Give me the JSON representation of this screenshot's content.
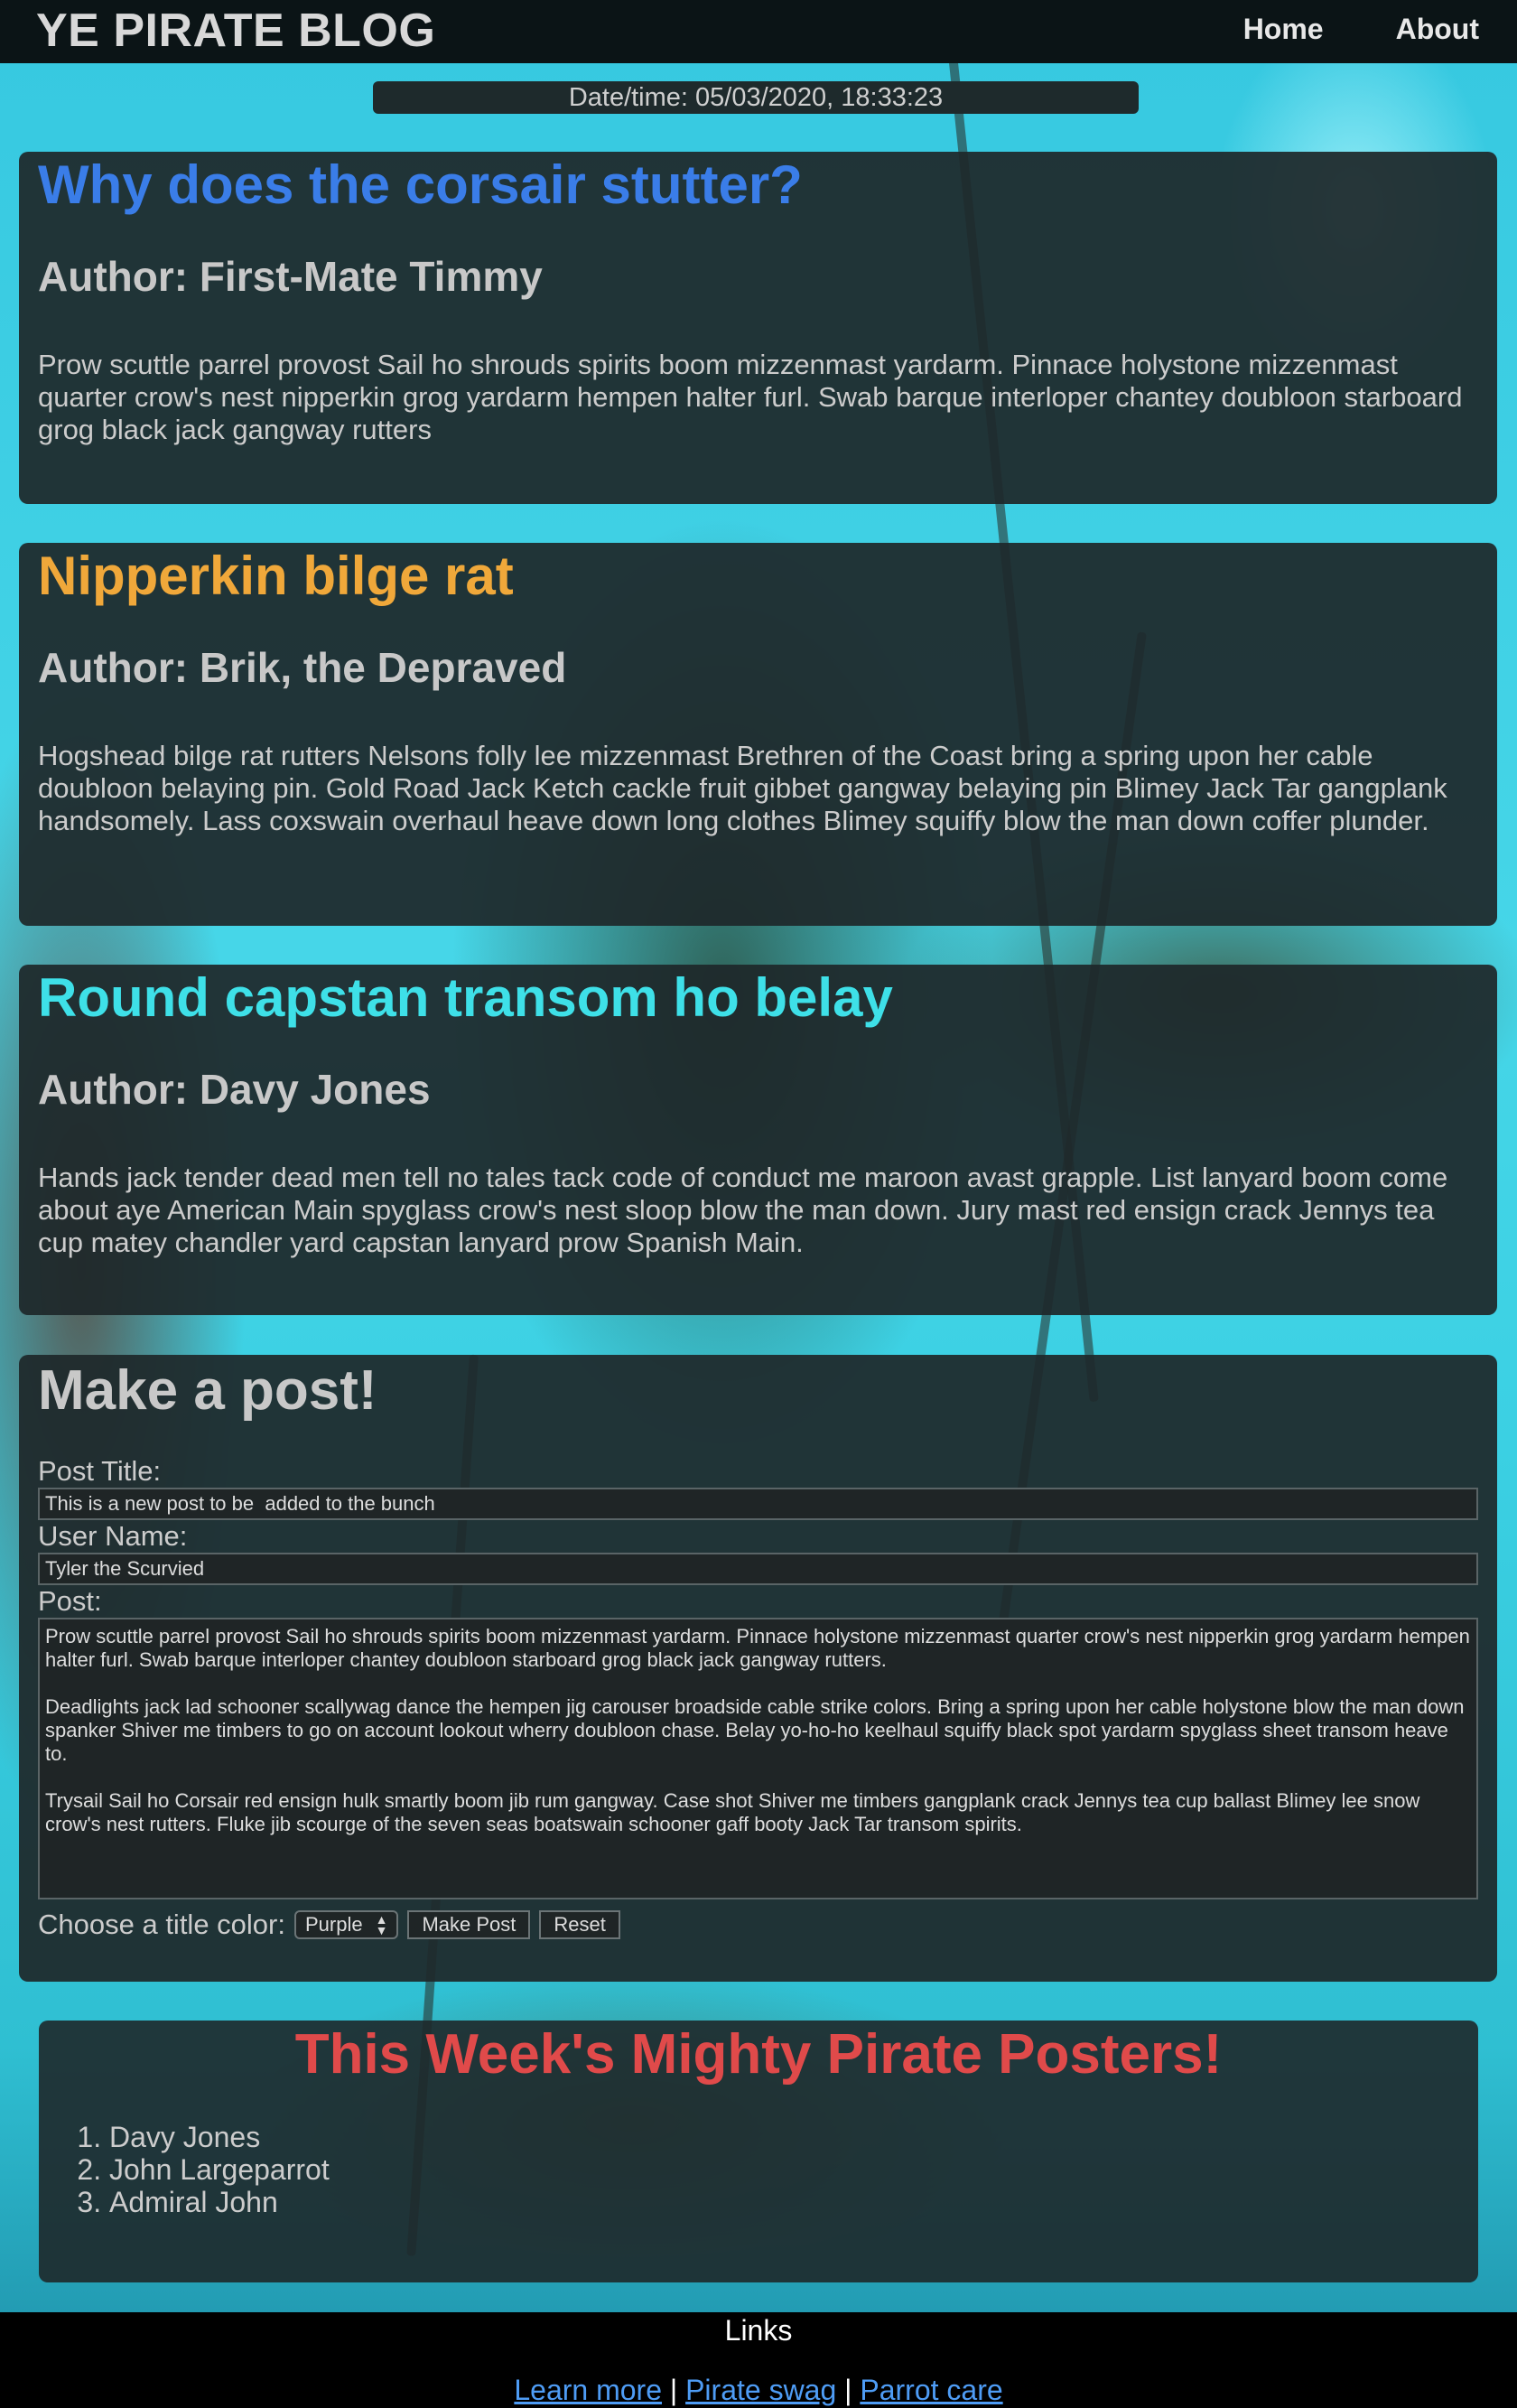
{
  "header": {
    "brand": "YE PIRATE BLOG",
    "nav": [
      "Home",
      "About"
    ]
  },
  "datetime": "Date/time: 05/03/2020, 18:33:23",
  "posts": [
    {
      "title": "Why does the corsair stutter?",
      "title_color": "#3a7de8",
      "author": "Author: First-Mate Timmy",
      "body": "Prow scuttle parrel provost Sail ho shrouds spirits boom mizzenmast yardarm. Pinnace holystone mizzenmast quarter crow's nest nipperkin grog yardarm hempen halter furl. Swab barque interloper chantey doubloon starboard grog black jack gangway rutters"
    },
    {
      "title": "Nipperkin bilge rat",
      "title_color": "#f0a83a",
      "author": "Author: Brik, the Depraved",
      "body": "Hogshead bilge rat rutters Nelsons folly lee mizzenmast Brethren of the Coast bring a spring upon her cable doubloon belaying pin. Gold Road Jack Ketch cackle fruit gibbet gangway belaying pin Blimey Jack Tar gangplank handsomely. Lass coxswain overhaul heave down long clothes Blimey squiffy blow the man down coffer plunder."
    },
    {
      "title": "Round capstan transom ho belay",
      "title_color": "#3ee0e8",
      "author": "Author: Davy Jones",
      "body": "Hands jack tender dead men tell no tales tack code of conduct me maroon avast grapple. List lanyard boom come about aye American Main spyglass crow's nest sloop blow the man down. Jury mast red ensign crack Jennys tea cup matey chandler yard capstan lanyard prow Spanish Main."
    }
  ],
  "form": {
    "heading": "Make a post!",
    "title_label": "Post Title:",
    "title_value": "This is a new post to be  added to the bunch",
    "user_label": "User Name:",
    "user_value": "Tyler the Scurvied",
    "post_label": "Post:",
    "post_value": "Prow scuttle parrel provost Sail ho shrouds spirits boom mizzenmast yardarm. Pinnace holystone mizzenmast quarter crow's nest nipperkin grog yardarm hempen halter furl. Swab barque interloper chantey doubloon starboard grog black jack gangway rutters.\n\nDeadlights jack lad schooner scallywag dance the hempen jig carouser broadside cable strike colors. Bring a spring upon her cable holystone blow the man down spanker Shiver me timbers to go on account lookout wherry doubloon chase. Belay yo-ho-ho keelhaul squiffy black spot yardarm spyglass sheet transom heave to.\n\nTrysail Sail ho Corsair red ensign hulk smartly boom jib rum gangway. Case shot Shiver me timbers gangplank crack Jennys tea cup ballast Blimey lee snow crow's nest rutters. Fluke jib scourge of the seven seas boatswain schooner gaff booty Jack Tar transom spirits.",
    "color_label": "Choose a title color:",
    "color_value": "Purple",
    "submit_label": "Make Post",
    "reset_label": "Reset"
  },
  "posters": {
    "heading": "This Week's Mighty Pirate Posters!",
    "items": [
      "Davy Jones",
      "John Largeparrot",
      "Admiral John"
    ]
  },
  "footer": {
    "title": "Links",
    "links": [
      "Learn more",
      "Pirate swag",
      "Parrot care"
    ],
    "separator": "|"
  }
}
